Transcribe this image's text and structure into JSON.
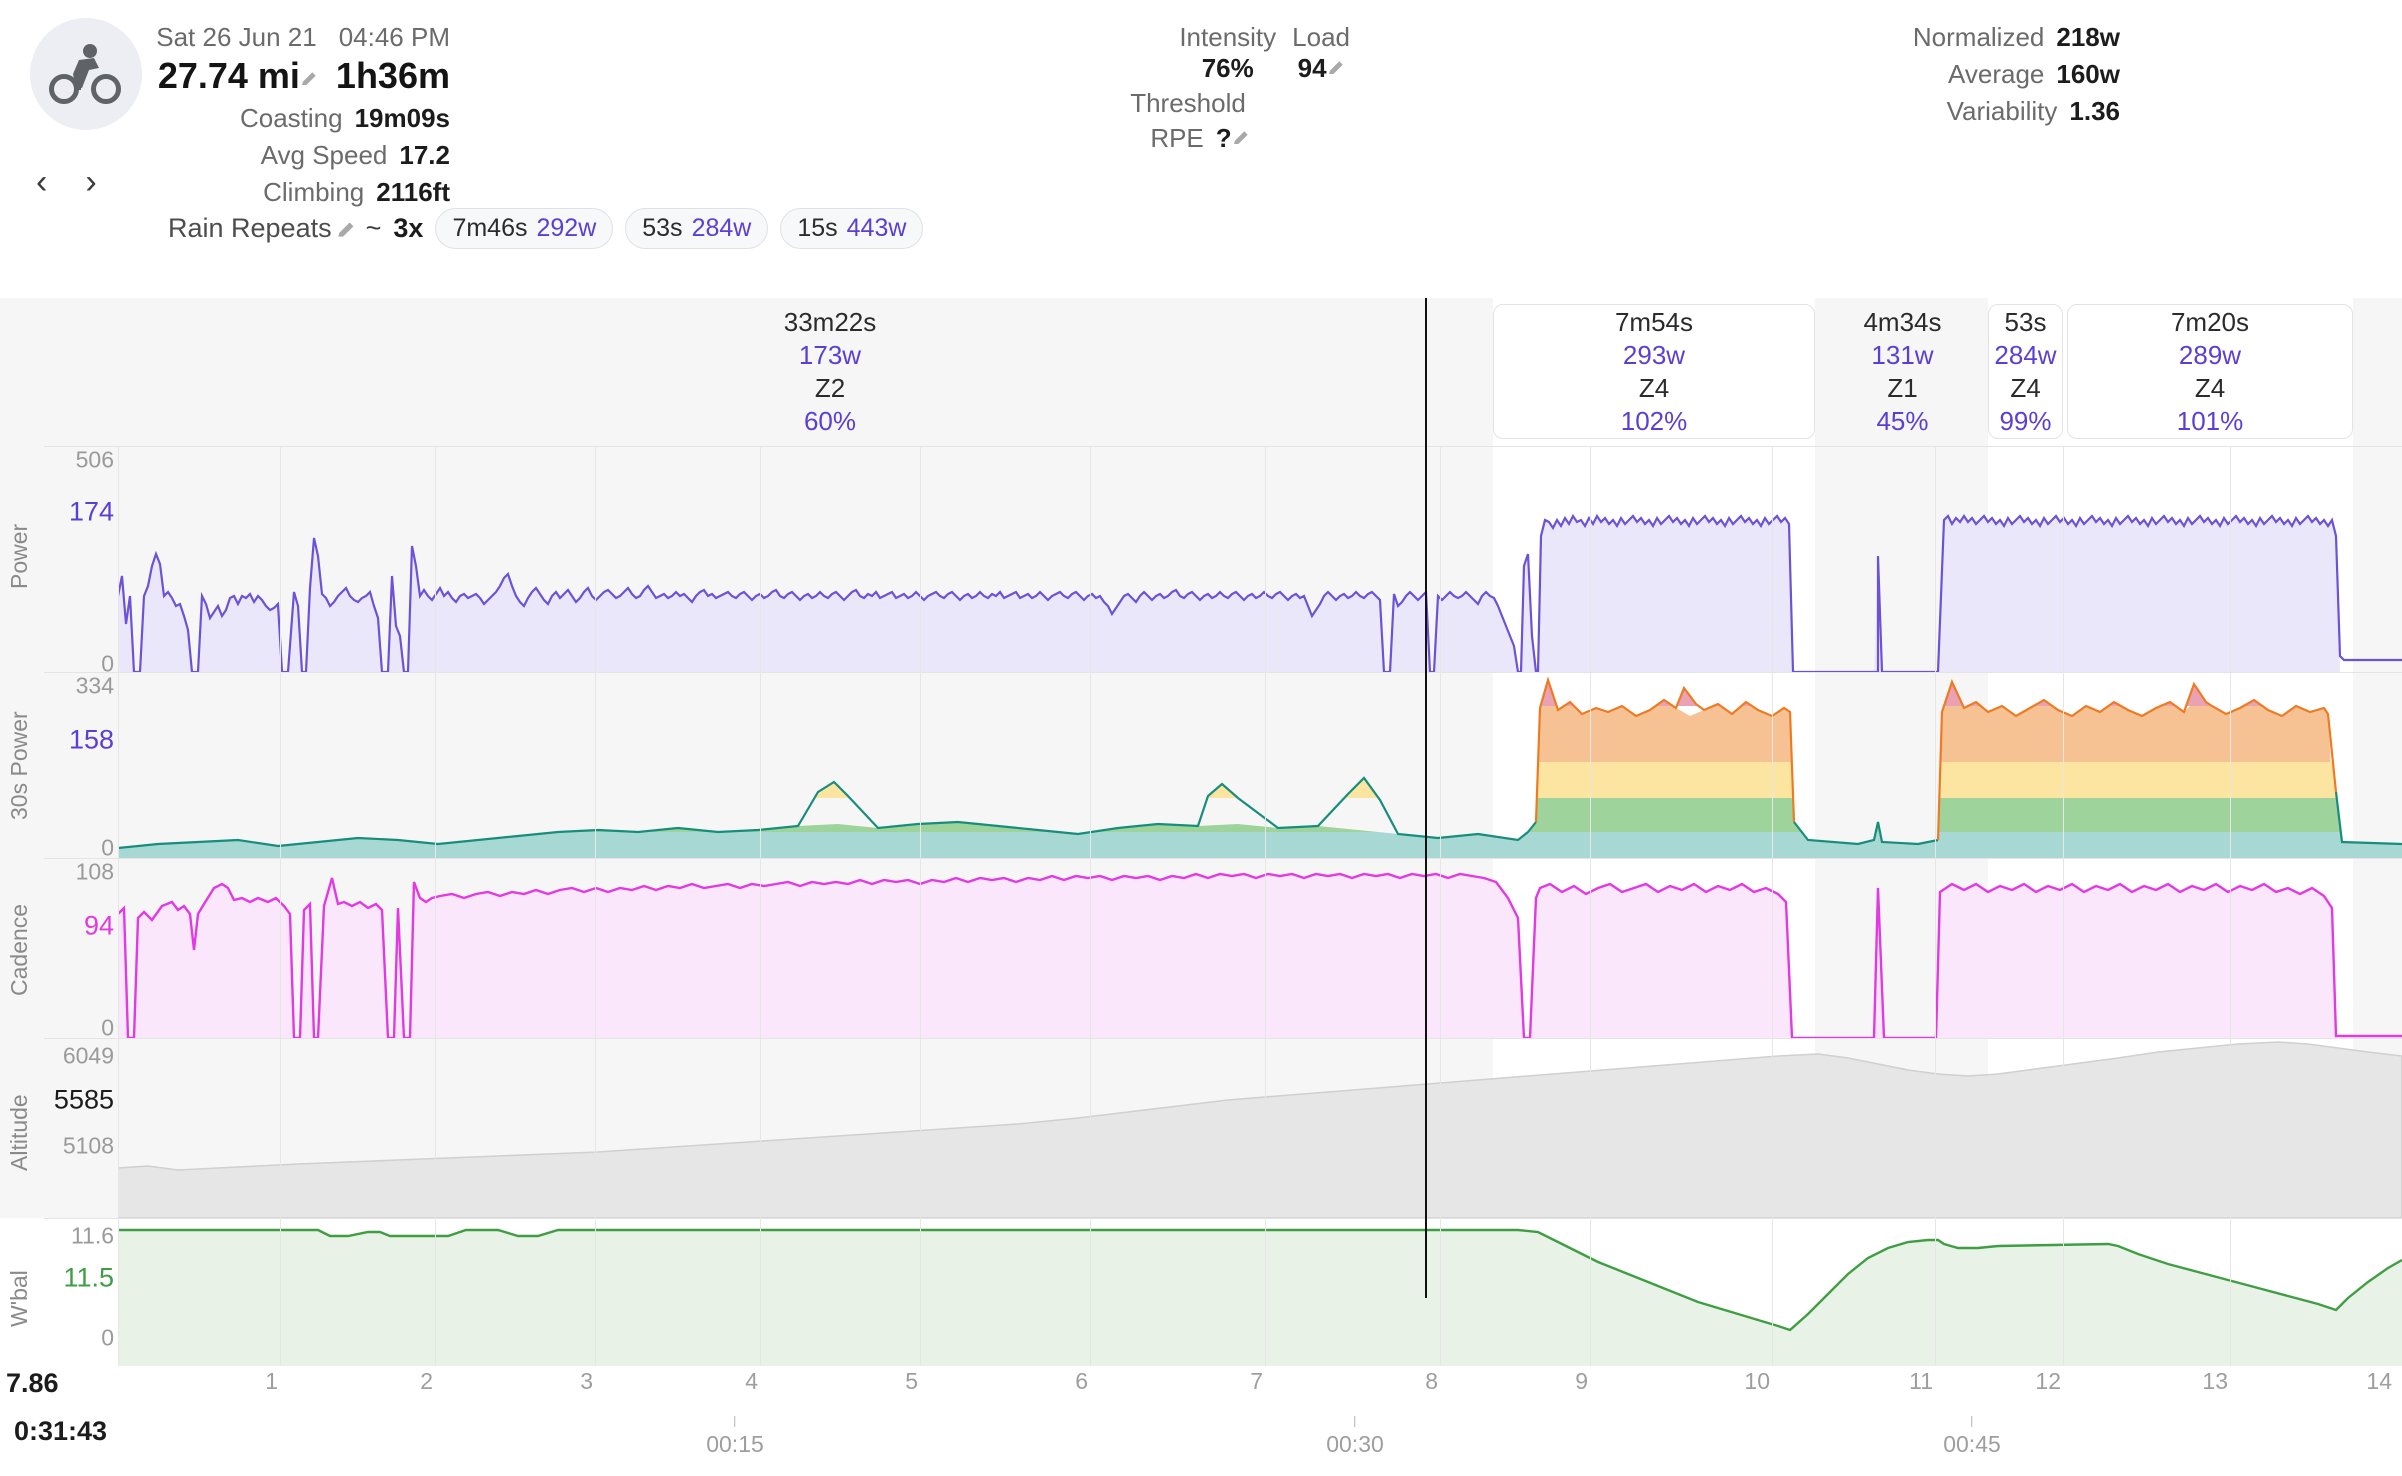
{
  "header": {
    "activity_icon": "cyclist-icon",
    "prev_label": "‹",
    "next_label": "›",
    "date": "Sat 26 Jun 21",
    "time": "04:46 PM",
    "distance": "27.74 mi",
    "duration": "1h36m",
    "stats": [
      {
        "label": "Coasting",
        "value": "19m09s"
      },
      {
        "label": "Avg Speed",
        "value": "17.2"
      },
      {
        "label": "Climbing",
        "value": "2116ft"
      }
    ],
    "middle": {
      "intensity_label": "Intensity",
      "intensity_value": "76%",
      "load_label": "Load",
      "load_value": "94",
      "threshold_label": "Threshold",
      "rpe_label": "RPE",
      "rpe_value": "?"
    },
    "right": [
      {
        "label": "Normalized",
        "value": "218w"
      },
      {
        "label": "Average",
        "value": "160w"
      },
      {
        "label": "Variability",
        "value": "1.36"
      }
    ],
    "workout": {
      "name": "Rain Repeats",
      "tilde": "~",
      "repeats": "3x",
      "pills": [
        {
          "time": "7m46s",
          "power": "292w"
        },
        {
          "time": "53s",
          "power": "284w"
        },
        {
          "time": "15s",
          "power": "443w"
        }
      ]
    }
  },
  "chart_data": {
    "type": "line",
    "title": "Ride analysis timeline",
    "xlabel_distance_unit": "mi",
    "xlabel_time_unit": "h:mm",
    "x_distance_ticks": [
      1,
      2,
      3,
      4,
      5,
      6,
      7,
      8,
      9,
      10,
      11,
      12,
      13,
      14
    ],
    "x_time_ticks": [
      "00:15",
      "00:30",
      "00:45"
    ],
    "cursor": {
      "distance": "7.86",
      "time": "0:31:43"
    },
    "accent_power": "#6c52d6",
    "accent_cadence": "#e23ae2",
    "accent_wbal": "#3f9e44",
    "accent_altitude": "#c8c8c8",
    "zone_colors": {
      "z1": "#a8d8d3",
      "z2": "#9ed49b",
      "z3": "#fbe5a0",
      "z4": "#f7c293",
      "z5": "#e9a1b4",
      "line_z1": "#178d7c",
      "line_z2": "#3c9a3f",
      "line_z3": "#e8b838",
      "line_z4": "#ee7b23",
      "line_z5": "#d1185a"
    },
    "intervals": [
      {
        "duration": "33m22s",
        "power": "173w",
        "zone": "Z2",
        "percent": "60%",
        "highlight": false
      },
      {
        "duration": "7m54s",
        "power": "293w",
        "zone": "Z4",
        "percent": "102%",
        "highlight": true
      },
      {
        "duration": "4m34s",
        "power": "131w",
        "zone": "Z1",
        "percent": "45%",
        "highlight": false
      },
      {
        "duration": "53s",
        "power": "284w",
        "zone": "Z4",
        "percent": "99%",
        "highlight": true
      },
      {
        "duration": "7m20s",
        "power": "289w",
        "zone": "Z4",
        "percent": "101%",
        "highlight": true
      }
    ],
    "panels": [
      {
        "name": "Power",
        "ticks": [
          "506",
          "174",
          "0"
        ],
        "highlight_index": 1,
        "highlight_color": "#5b3fd4",
        "ymax": 506,
        "ycur": 174
      },
      {
        "name": "30s Power",
        "ticks": [
          "334",
          "158",
          "0"
        ],
        "highlight_index": 1,
        "highlight_color": "#5b3fd4",
        "ymax": 334,
        "ycur": 158
      },
      {
        "name": "Cadence",
        "ticks": [
          "108",
          "94",
          "0"
        ],
        "highlight_index": 1,
        "highlight_color": "#e23ae2",
        "ymax": 108,
        "ycur": 94
      },
      {
        "name": "Altitude",
        "ticks": [
          "6049",
          "5585",
          "5108"
        ],
        "highlight_index": 1,
        "highlight_color": "#1c1c1c",
        "ymax": 6049,
        "ycur": 5585
      },
      {
        "name": "W'bal",
        "ticks": [
          "11.6",
          "11.5",
          "0"
        ],
        "highlight_index": 1,
        "highlight_color": "#3f9e44",
        "ymax": 11.6,
        "ycur": 11.5
      }
    ]
  }
}
